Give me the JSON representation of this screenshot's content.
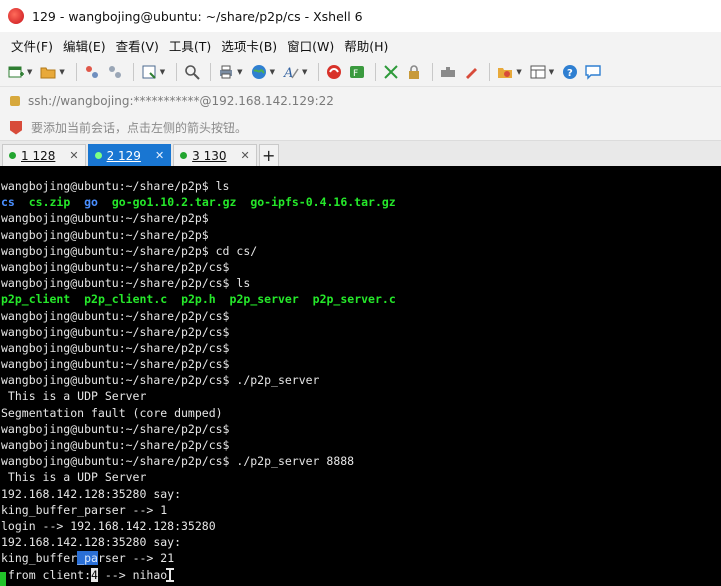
{
  "window": {
    "title": "129 - wangbojing@ubuntu: ~/share/p2p/cs - Xshell 6"
  },
  "menu": [
    "文件(F)",
    "编辑(E)",
    "查看(V)",
    "工具(T)",
    "选项卡(B)",
    "窗口(W)",
    "帮助(H)"
  ],
  "address": {
    "text": "ssh://wangbojing:***********@192.168.142.129:22"
  },
  "hint": {
    "text": "要添加当前会话，点击左侧的箭头按钮。"
  },
  "tabs": [
    {
      "label": "1 128",
      "active": false
    },
    {
      "label": "2 129",
      "active": true
    },
    {
      "label": "3 130",
      "active": false
    }
  ],
  "tab_add_label": "+",
  "terminal": {
    "l1": "wangbojing@ubuntu:~/share/p2p$ ls",
    "l2": {
      "a": "cs",
      "b": "cs.zip",
      "c": "go",
      "d": "go-go1.10.2.tar.gz",
      "e": "go-ipfs-0.4.16.tar.gz"
    },
    "l3": "wangbojing@ubuntu:~/share/p2p$",
    "l4": "wangbojing@ubuntu:~/share/p2p$",
    "l5": "wangbojing@ubuntu:~/share/p2p$ cd cs/",
    "l6": "wangbojing@ubuntu:~/share/p2p/cs$",
    "l7": "wangbojing@ubuntu:~/share/p2p/cs$ ls",
    "l8": {
      "a": "p2p_client",
      "b": "p2p_client.c",
      "c": "p2p.h",
      "d": "p2p_server",
      "e": "p2p_server.c"
    },
    "l9": "wangbojing@ubuntu:~/share/p2p/cs$",
    "l10": "wangbojing@ubuntu:~/share/p2p/cs$",
    "l11": "wangbojing@ubuntu:~/share/p2p/cs$",
    "l12": "wangbojing@ubuntu:~/share/p2p/cs$",
    "l13": "wangbojing@ubuntu:~/share/p2p/cs$ ./p2p_server",
    "l14": " This is a UDP Server",
    "l15": "Segmentation fault (core dumped)",
    "l16": "wangbojing@ubuntu:~/share/p2p/cs$",
    "l17": "wangbojing@ubuntu:~/share/p2p/cs$",
    "l18": "wangbojing@ubuntu:~/share/p2p/cs$ ./p2p_server 8888",
    "l19": " This is a UDP Server",
    "l20": "192.168.142.128:35280 say:",
    "l21": "king_buffer_parser --> 1",
    "l22": "login --> 192.168.142.128:35280",
    "l23": "192.168.142.128:35280 say:",
    "l24": {
      "pre": "king_buffer",
      "sel": "_pa",
      "post": "rser --> 21"
    },
    "l25": {
      "pre": " from client:",
      "cur": "4",
      "post": " --> nihao"
    }
  }
}
